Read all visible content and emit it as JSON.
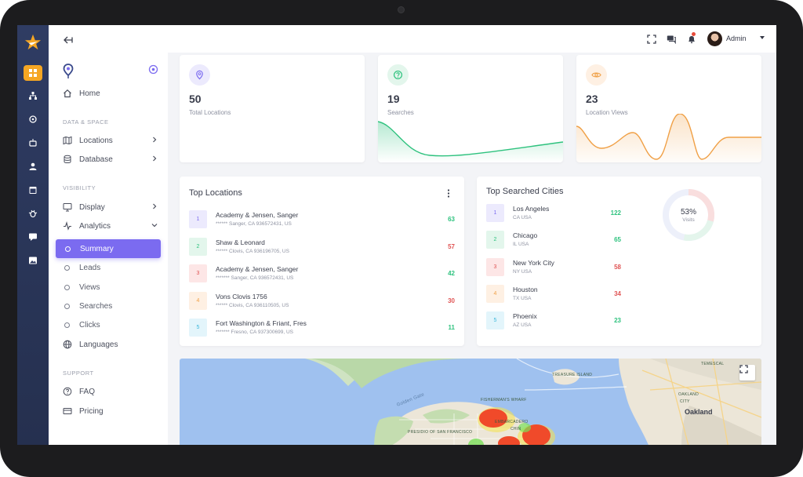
{
  "topbar": {
    "user_name": "Admin"
  },
  "sidebar": {
    "home": "Home",
    "sections": {
      "data_space": "DATA & SPACE",
      "visibility": "VISIBILITY",
      "support": "SUPPORT"
    },
    "items": {
      "locations": "Locations",
      "database": "Database",
      "display": "Display",
      "analytics": "Analytics",
      "languages": "Languages",
      "faq": "FAQ",
      "pricing": "Pricing"
    },
    "analytics_sub": {
      "summary": "Summary",
      "leads": "Leads",
      "views": "Views",
      "searches": "Searches",
      "clicks": "Clicks"
    }
  },
  "stats": [
    {
      "value": "50",
      "label": "Total Locations",
      "icon": "location-pin-icon",
      "color": "#7b6bf0"
    },
    {
      "value": "19",
      "label": "Searches",
      "icon": "question-circle-icon",
      "color": "#2ec27e"
    },
    {
      "value": "23",
      "label": "Location Views",
      "icon": "eye-icon",
      "color": "#f0a046"
    }
  ],
  "top_locations": {
    "title": "Top Locations",
    "rows": [
      {
        "rank": "1",
        "name": "Academy & Jensen, Sanger",
        "address": "****** Sanger, CA 936572431, US",
        "value": "63"
      },
      {
        "rank": "2",
        "name": "Shaw & Leonard",
        "address": "****** Clovis, CA 936196705, US",
        "value": "57"
      },
      {
        "rank": "3",
        "name": "Academy & Jensen, Sanger",
        "address": "******* Sanger, CA 936572431, US",
        "value": "42"
      },
      {
        "rank": "4",
        "name": "Vons Clovis 1756",
        "address": "****** Clovis, CA 936110505, US",
        "value": "30"
      },
      {
        "rank": "5",
        "name": "Fort Washington & Friant, Fres",
        "address": "******* Fresno, CA 937300699, US",
        "value": "11"
      }
    ]
  },
  "top_cities": {
    "title": "Top Searched Cities",
    "rows": [
      {
        "rank": "1",
        "name": "Los Angeles",
        "state": "CA USA",
        "value": "122"
      },
      {
        "rank": "2",
        "name": "Chicago",
        "state": "IL USA",
        "value": "65"
      },
      {
        "rank": "3",
        "name": "New York City",
        "state": "NY USA",
        "value": "58"
      },
      {
        "rank": "4",
        "name": "Houston",
        "state": "TX USA",
        "value": "34"
      },
      {
        "rank": "5",
        "name": "Phoenix",
        "state": "AZ USA",
        "value": "23"
      }
    ],
    "donut_percent": "53%",
    "donut_label": "Visits",
    "donut_fraction": 0.53
  },
  "row_colors": [
    {
      "bg": "#eceafd",
      "fg": "#7b6bf0"
    },
    {
      "bg": "#e3f6ec",
      "fg": "#2ec27e"
    },
    {
      "bg": "#fde6e6",
      "fg": "#e05555"
    },
    {
      "bg": "#fef0e3",
      "fg": "#f0a046"
    },
    {
      "bg": "#e3f5fb",
      "fg": "#3fb8db"
    }
  ],
  "value_colors": [
    "#2ec27e",
    "#e05555",
    "#2ec27e",
    "#e05555",
    "#2ec27e"
  ],
  "city_value_colors": [
    "#2ec27e",
    "#2ec27e",
    "#e05555",
    "#e05555",
    "#2ec27e"
  ],
  "map": {
    "labels": {
      "golden_gate": "Golden Gate",
      "treasure_island": "TREASURE ISLAND",
      "fishermans_wharf": "FISHERMAN'S WHARF",
      "embarcadero": "EMBARCADERO",
      "presidio": "PRESIDIO OF SAN FRANCISCO",
      "china": "CHIN",
      "temescal": "TEMESCAL",
      "oakland_label": "OAKLAND",
      "oakland_city": "Oakland",
      "city": "CITY"
    }
  }
}
